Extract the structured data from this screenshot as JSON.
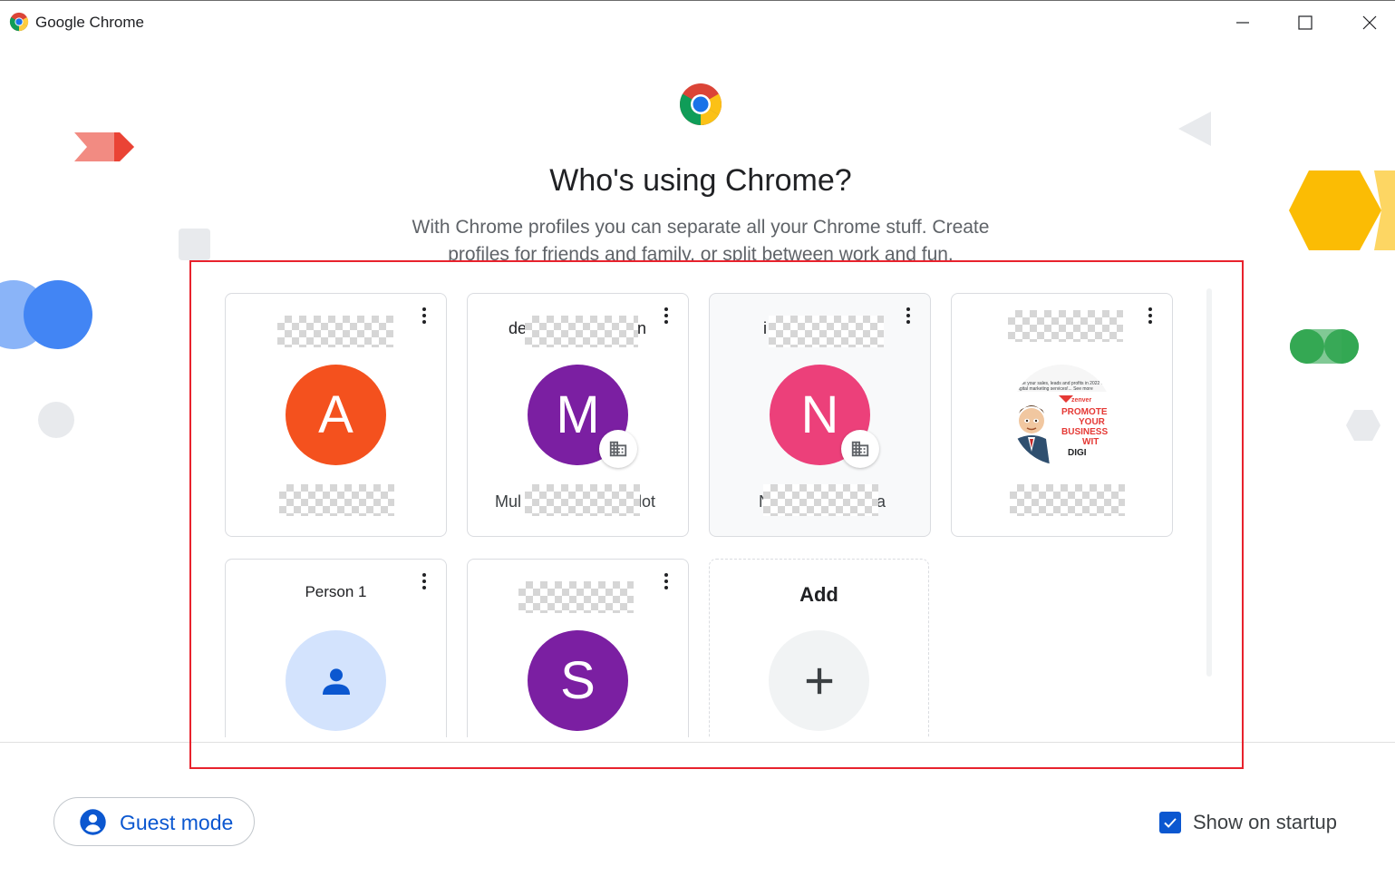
{
  "window": {
    "title": "Google Chrome",
    "controls": [
      "minimize",
      "maximize",
      "close"
    ]
  },
  "header": {
    "heading": "Who's using Chrome?",
    "subtitle": "With Chrome profiles you can separate all your Chrome stuff. Create profiles for friends and family, or split between work and fun."
  },
  "profiles": [
    {
      "name_visible": "",
      "initial": "A",
      "avatar_color": "#f4511e",
      "managed": false,
      "email_visible": ""
    },
    {
      "name_prefix": "de",
      "name_suffix": "n",
      "initial": "M",
      "avatar_color": "#7b1fa2",
      "managed": true,
      "email_prefix": "Mul",
      "email_suffix": "lot"
    },
    {
      "name_prefix": "i",
      "initial": "N",
      "avatar_color": "#ec407a",
      "managed": true,
      "email_prefix": "N",
      "email_suffix": "a"
    },
    {
      "name_visible": "",
      "photo": true,
      "photo_text": [
        "PROMOTE",
        "YOUR",
        "BUSINESS",
        "WIT",
        "DIGI"
      ],
      "photo_brand": "zenver",
      "photo_caption": "ease your sales, leads and profits in 2022 w ur digital marketing services!... See more",
      "email_visible": ""
    },
    {
      "name": "Person 1",
      "avatar_color": "#d3e3fd",
      "icon": "person-icon"
    },
    {
      "name_visible": "",
      "initial": "S",
      "avatar_color": "#7b1fa2",
      "managed": false
    }
  ],
  "add_card": {
    "label": "Add",
    "icon": "plus-icon"
  },
  "footer": {
    "guest_label": "Guest mode",
    "show_on_startup_label": "Show on startup",
    "show_on_startup_checked": true
  },
  "colors": {
    "accent": "#0b57d0",
    "highlight_border": "#e8222d"
  }
}
